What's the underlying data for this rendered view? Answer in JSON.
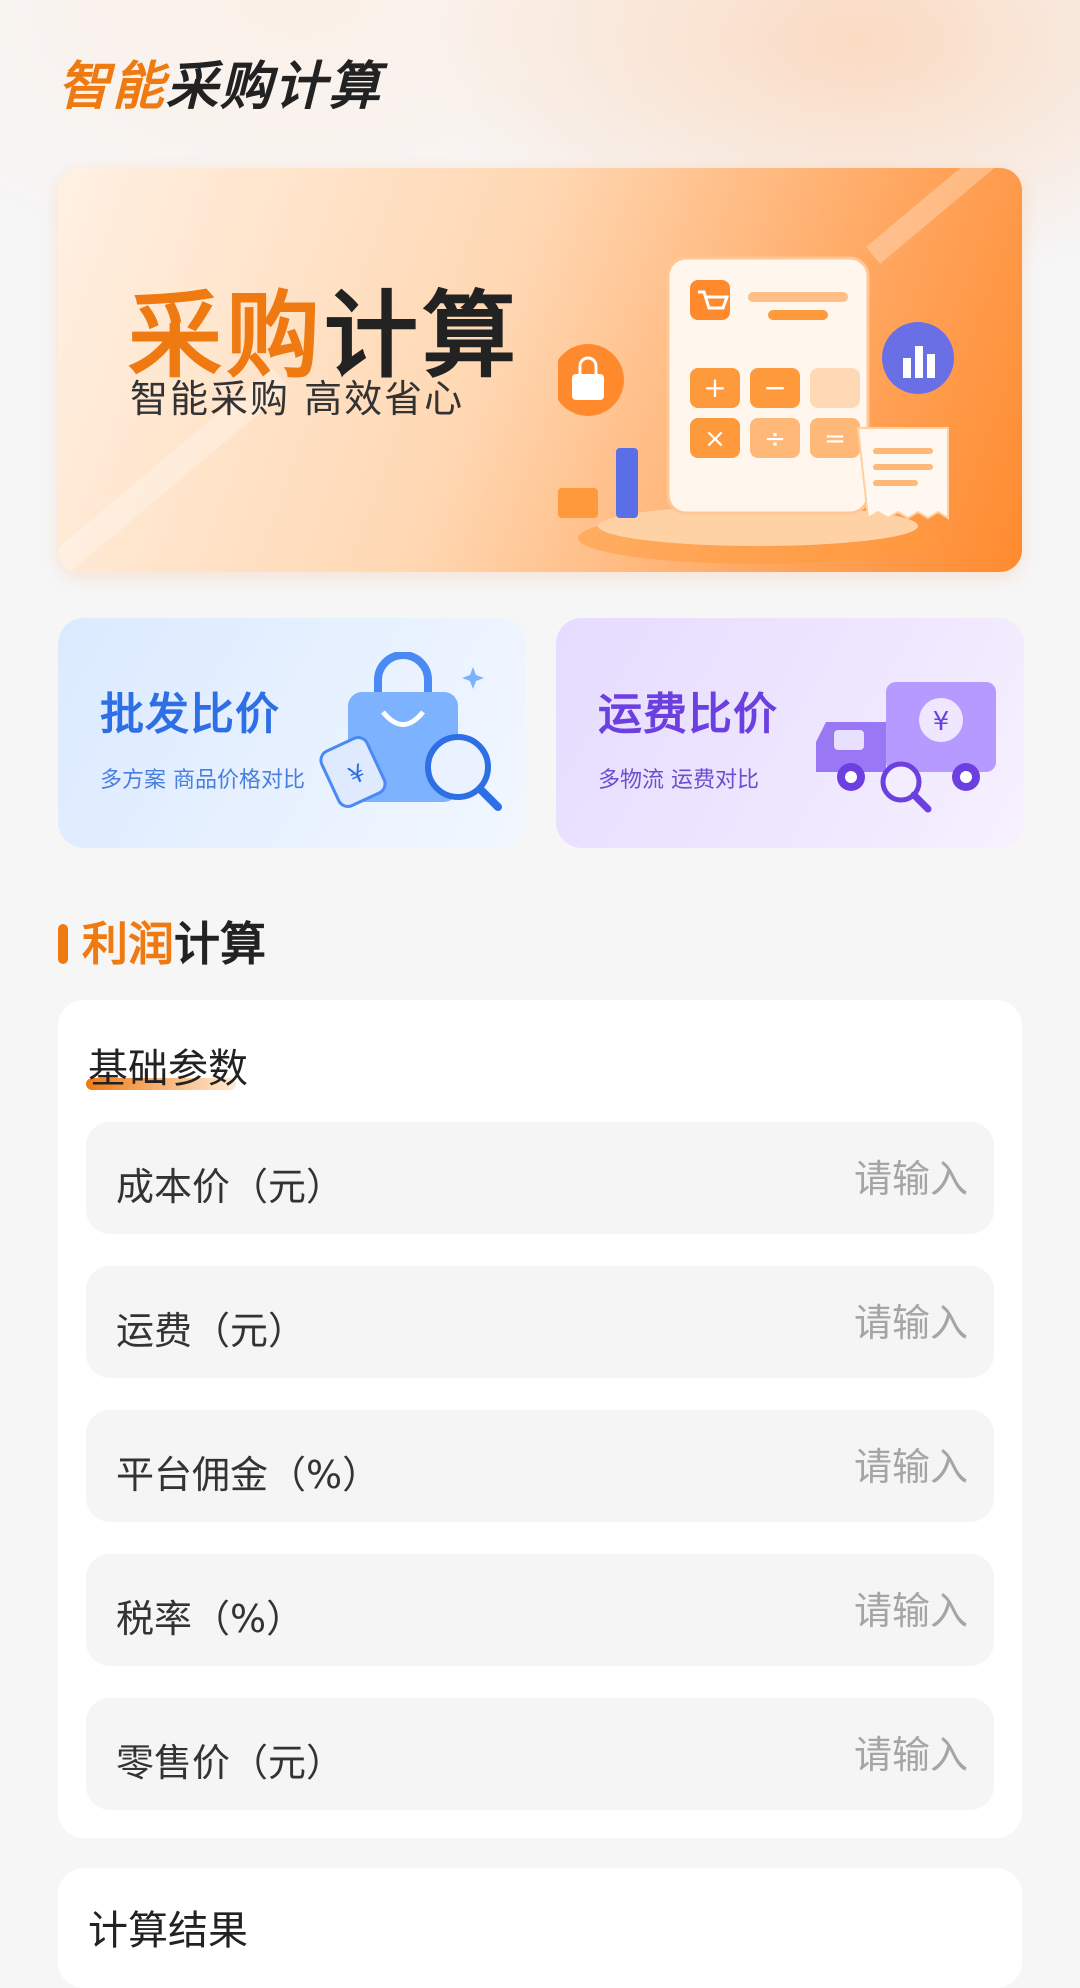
{
  "header": {
    "title_accent": "智能",
    "title_rest": "采购计算"
  },
  "hero": {
    "title_accent": "采购",
    "title_rest": "计算",
    "subtitle": "智能采购 高效省心"
  },
  "cards": [
    {
      "title": "批发比价",
      "subtitle": "多方案 商品价格对比",
      "icon": "shopping-bag-price-tag-icon"
    },
    {
      "title": "运费比价",
      "subtitle": "多物流 运费对比",
      "icon": "delivery-truck-icon"
    }
  ],
  "section": {
    "title_accent": "利润",
    "title_rest": "计算"
  },
  "form": {
    "title": "基础参数",
    "fields": [
      {
        "label": "成本价（元）",
        "placeholder": "请输入",
        "value": ""
      },
      {
        "label": "运费（元）",
        "placeholder": "请输入",
        "value": ""
      },
      {
        "label": "平台佣金（%）",
        "placeholder": "请输入",
        "value": ""
      },
      {
        "label": "税率（%）",
        "placeholder": "请输入",
        "value": ""
      },
      {
        "label": "零售价（元）",
        "placeholder": "请输入",
        "value": ""
      }
    ]
  },
  "results": {
    "title": "计算结果"
  },
  "colors": {
    "accent": "#f07a12",
    "blue": "#2f6fe6",
    "purple": "#6b3fe0",
    "background": "#f6f6f7"
  }
}
